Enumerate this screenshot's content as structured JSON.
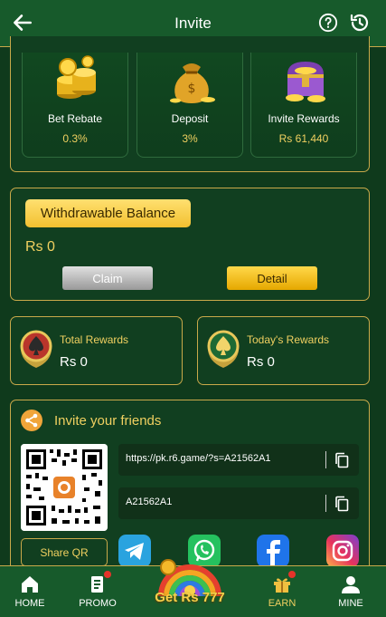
{
  "header": {
    "title": "Invite",
    "back_icon": "arrow-left-icon",
    "help_icon": "question-circle-icon",
    "history_icon": "history-icon"
  },
  "rewards": [
    {
      "label": "Bet Rebate",
      "value": "0.3%",
      "icon": "gold-coins-icon"
    },
    {
      "label": "Deposit",
      "value": "3%",
      "icon": "money-bag-icon"
    },
    {
      "label": "Invite Rewards",
      "value": "Rs 61,440",
      "icon": "treasure-chest-icon"
    }
  ],
  "balance": {
    "label": "Withdrawable Balance",
    "amount": "Rs 0",
    "claim_label": "Claim",
    "detail_label": "Detail"
  },
  "stats": [
    {
      "label": "Total Rewards",
      "value": "Rs 0",
      "icon": "spade-medal-icon"
    },
    {
      "label": "Today's Rewards",
      "value": "Rs 0",
      "icon": "spade-medal-icon"
    }
  ],
  "invite": {
    "title": "Invite your friends",
    "link": "https://pk.r6.game/?s=A21562A1",
    "code": "A21562A1",
    "share_qr_label": "Share QR",
    "socials": [
      "telegram-icon",
      "whatsapp-icon",
      "facebook-icon",
      "instagram-icon"
    ]
  },
  "nav": {
    "items": [
      {
        "label": "HOME",
        "icon": "home-icon"
      },
      {
        "label": "PROMO",
        "icon": "promo-icon"
      },
      {
        "label": "EARN",
        "icon": "gift-icon"
      },
      {
        "label": "MINE",
        "icon": "user-icon"
      }
    ],
    "center_label": "Get Rs 777"
  },
  "colors": {
    "background": "#0f3a1c",
    "accent_gold": "#f0d060",
    "border_gold": "#c9a94a",
    "header_green": "#175a2b"
  }
}
